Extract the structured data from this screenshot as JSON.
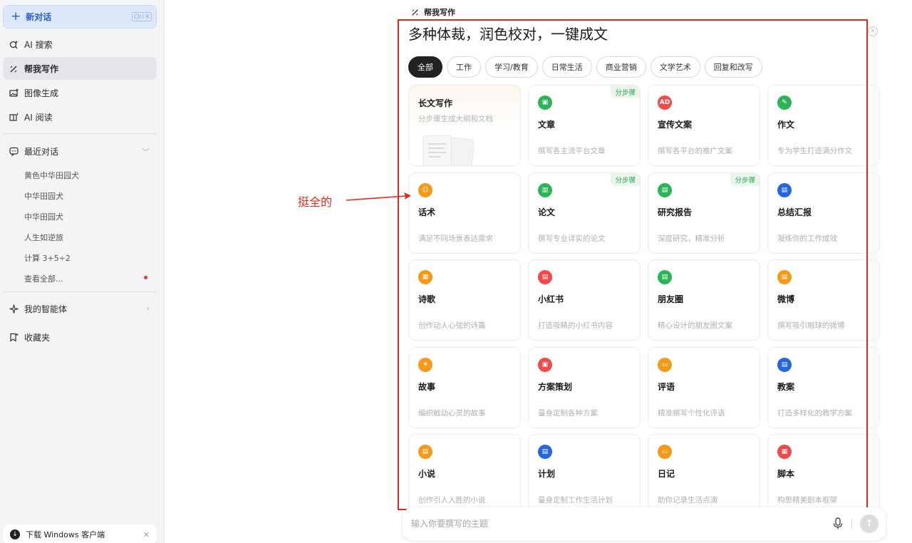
{
  "sidebar": {
    "new_chat": {
      "label": "新对话",
      "shortcut": "Ctrl K"
    },
    "nav": [
      {
        "label": "AI 搜索",
        "icon": "search-sparkle-icon"
      },
      {
        "label": "帮我写作",
        "icon": "pen-sparkle-icon",
        "active": true
      },
      {
        "label": "图像生成",
        "icon": "image-plus-icon"
      },
      {
        "label": "AI 阅读",
        "icon": "book-sparkle-icon"
      }
    ],
    "recent": {
      "label": "最近对话",
      "items": [
        "黄色中华田园犬",
        "中华田园犬",
        "中华田园犬",
        "人生如逆旅",
        "计算 3+5÷2",
        "查看全部..."
      ]
    },
    "agents_label": "我的智能体",
    "favorites_label": "收藏夹",
    "download_label": "下载 Windows 客户端"
  },
  "panel": {
    "header": "帮我写作",
    "title": "多种体裁，润色校对，一键成文",
    "tabs": [
      "全部",
      "工作",
      "学习/教育",
      "日常生活",
      "商业营销",
      "文学艺术",
      "回复和改写"
    ],
    "long_card": {
      "title": "长文写作",
      "desc": "分步骤生成大纲和文档"
    },
    "cards": [
      {
        "title": "文章",
        "desc": "撰写各主流平台文章",
        "color": "#2fb35a",
        "glyph": "▣",
        "badge": "分步骤"
      },
      {
        "title": "宣传文案",
        "desc": "撰写各平台的推广文案",
        "color": "#ef4b4b",
        "glyph": "AD"
      },
      {
        "title": "作文",
        "desc": "专为学生打造满分作文",
        "color": "#2fb35a",
        "glyph": "✎"
      },
      {
        "title": "话术",
        "desc": "满足不同场景表达需求",
        "color": "#f39a1a",
        "glyph": "☺"
      },
      {
        "title": "论文",
        "desc": "撰写专业详实的论文",
        "color": "#2fb35a",
        "glyph": "▥",
        "badge": "分步骤"
      },
      {
        "title": "研究报告",
        "desc": "深度研究，精准分析",
        "color": "#2fb35a",
        "glyph": "▤",
        "badge": "分步骤"
      },
      {
        "title": "总结汇报",
        "desc": "凝练你的工作成效",
        "color": "#2667e0",
        "glyph": "▤"
      },
      {
        "title": "诗歌",
        "desc": "创作动人心弦的诗篇",
        "color": "#f39a1a",
        "glyph": "▦"
      },
      {
        "title": "小红书",
        "desc": "打造吸睛的小红书内容",
        "color": "#ef4b4b",
        "glyph": "▤"
      },
      {
        "title": "朋友圈",
        "desc": "精心设计的朋友圈文案",
        "color": "#2fb35a",
        "glyph": "▤"
      },
      {
        "title": "微博",
        "desc": "撰写吸引眼球的微博",
        "color": "#f39a1a",
        "glyph": "▤"
      },
      {
        "title": "故事",
        "desc": "编织触动心灵的故事",
        "color": "#f39a1a",
        "glyph": "☀"
      },
      {
        "title": "方案策划",
        "desc": "量身定制各种方案",
        "color": "#ef4b4b",
        "glyph": "▣"
      },
      {
        "title": "评语",
        "desc": "精准撰写个性化评语",
        "color": "#f39a1a",
        "glyph": "▭"
      },
      {
        "title": "教案",
        "desc": "打造多样化的教学方案",
        "color": "#2667e0",
        "glyph": "▤"
      },
      {
        "title": "小说",
        "desc": "创作引人入胜的小说",
        "color": "#f39a1a",
        "glyph": "▤"
      },
      {
        "title": "计划",
        "desc": "量身定制工作生活计划",
        "color": "#2667e0",
        "glyph": "▤"
      },
      {
        "title": "日记",
        "desc": "助你记录生活点滴",
        "color": "#f39a1a",
        "glyph": "▭"
      },
      {
        "title": "脚本",
        "desc": "构思精美剧本框架",
        "color": "#ef4b4b",
        "glyph": "▦"
      }
    ],
    "input_placeholder": "输入你要撰写的主题"
  },
  "annotation": {
    "text": "挺全的",
    "color": "#e0281e"
  }
}
